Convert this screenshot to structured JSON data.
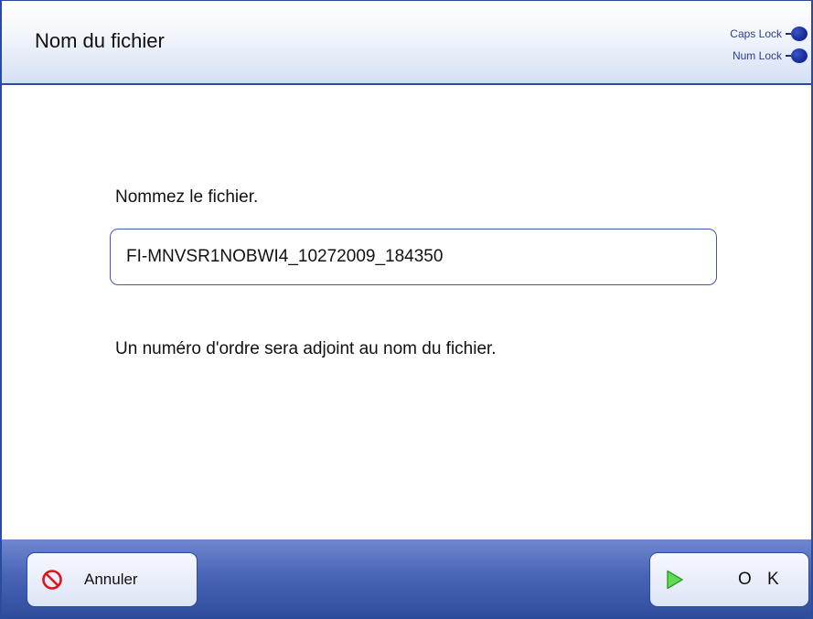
{
  "header": {
    "title": "Nom du fichier",
    "indicators": {
      "caps_lock": "Caps Lock",
      "num_lock": "Num Lock"
    }
  },
  "main": {
    "prompt": "Nommez le fichier.",
    "file_name_value": "FI-MNVSR1NOBWI4_10272009_184350",
    "note": "Un numéro d'ordre sera adjoint au nom du fichier."
  },
  "footer": {
    "cancel_label": "Annuler",
    "ok_label": "O K"
  },
  "icons": {
    "cancel": "no-entry-icon",
    "ok": "play-arrow-icon"
  },
  "colors": {
    "accent": "#2a4c9e",
    "footer_bar": "#4a65b8",
    "indicator": "#1a2f9e",
    "cancel_icon": "#e0141a",
    "ok_icon": "#3cc23c"
  }
}
